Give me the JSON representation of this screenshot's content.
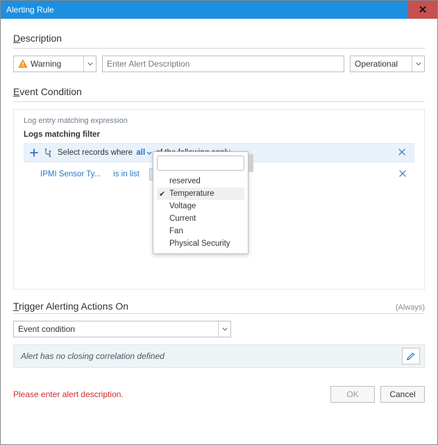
{
  "window": {
    "title": "Alerting Rule"
  },
  "description": {
    "header": "Description",
    "level": "Warning",
    "placeholder": "Enter Alert Description",
    "state": "Operational"
  },
  "eventCondition": {
    "header": "Event Condition",
    "sub1": "Log entry matching expression",
    "sub2": "Logs matching filter",
    "filter": {
      "prefix": "Select records where",
      "mode": "all",
      "suffix": "of the following apply"
    },
    "conditions": [
      {
        "field": "IPMI Sensor Ty...",
        "op": "is in list",
        "value": "Temperature"
      }
    ],
    "popup": {
      "options": [
        {
          "label": "reserved",
          "selected": false
        },
        {
          "label": "Temperature",
          "selected": true
        },
        {
          "label": "Voltage",
          "selected": false
        },
        {
          "label": "Current",
          "selected": false
        },
        {
          "label": "Fan",
          "selected": false
        },
        {
          "label": "Physical Security",
          "selected": false
        }
      ]
    }
  },
  "trigger": {
    "header": "Trigger Alerting Actions On",
    "always": "(Always)",
    "value": "Event condition",
    "info": "Alert has no closing correlation defined"
  },
  "footer": {
    "error": "Please enter alert description.",
    "ok": "OK",
    "cancel": "Cancel"
  }
}
